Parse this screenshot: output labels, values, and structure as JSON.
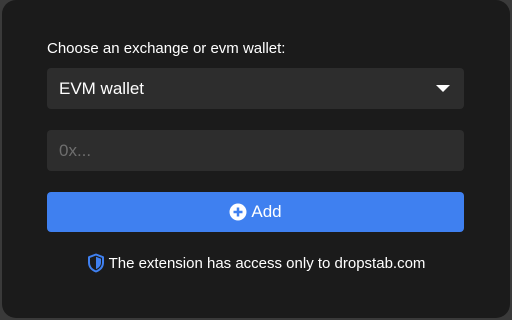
{
  "form": {
    "label": "Choose an exchange or evm wallet:",
    "select_value": "EVM wallet",
    "address_placeholder": "0x...",
    "address_value": "",
    "add_label": "Add"
  },
  "notice": {
    "text": "The extension has access only to dropstab.com"
  },
  "icons": {
    "dropdown": "caret-down-icon",
    "add": "plus-circle-icon",
    "notice": "shield-icon"
  },
  "colors": {
    "background": "#1b1b1b",
    "field": "#2d2d2d",
    "accent": "#3f80f0",
    "shield": "#3f80f0"
  }
}
